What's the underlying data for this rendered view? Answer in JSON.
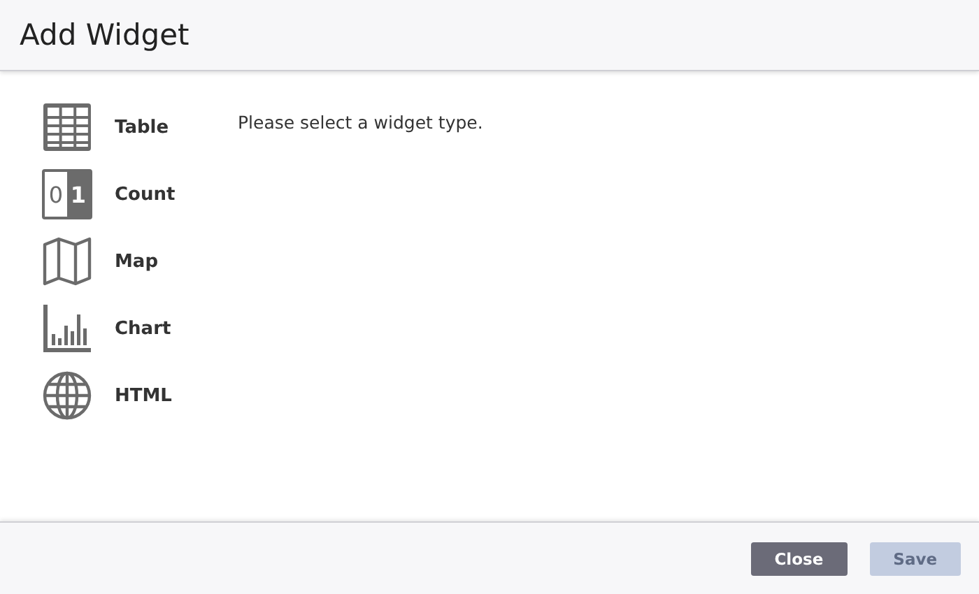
{
  "dialog": {
    "title": "Add Widget"
  },
  "widget_types": [
    {
      "kind": "table",
      "label": "Table"
    },
    {
      "kind": "count",
      "label": "Count",
      "icon_digits": [
        "0",
        "1"
      ]
    },
    {
      "kind": "map",
      "label": "Map"
    },
    {
      "kind": "chart",
      "label": "Chart"
    },
    {
      "kind": "html",
      "label": "HTML"
    }
  ],
  "message": "Please select a widget type.",
  "buttons": [
    {
      "label": "Close",
      "disabled": false
    },
    {
      "label": "Save",
      "disabled": true
    }
  ]
}
